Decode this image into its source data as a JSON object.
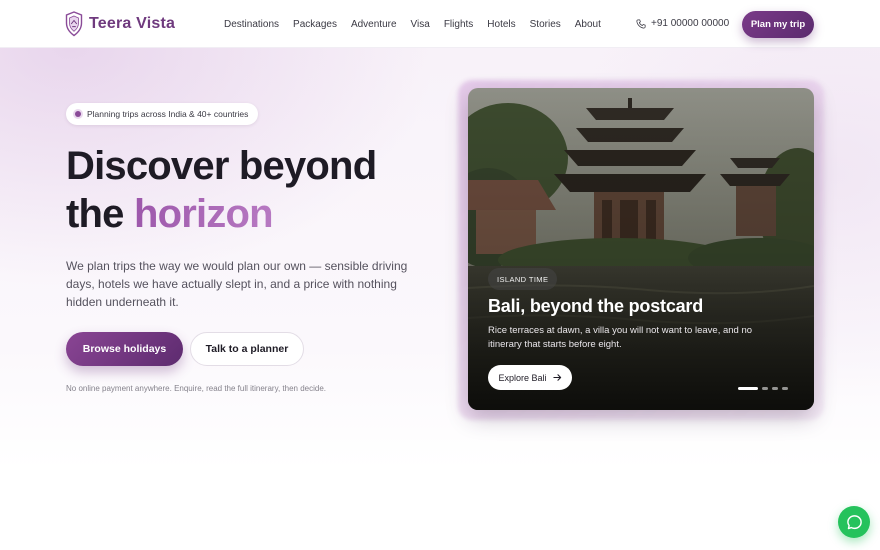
{
  "brand": {
    "name": "Teera Vista",
    "logo_icon": "shield-crest-icon",
    "color": "#6f3a7e"
  },
  "nav": {
    "items": [
      {
        "label": "Destinations"
      },
      {
        "label": "Packages"
      },
      {
        "label": "Adventure"
      },
      {
        "label": "Visa"
      },
      {
        "label": "Flights"
      },
      {
        "label": "Hotels"
      },
      {
        "label": "Stories"
      },
      {
        "label": "About"
      }
    ],
    "phone": "+91 00000 00000",
    "phone_icon": "phone-icon",
    "cta_label": "Plan my trip"
  },
  "hero": {
    "pill_text": "Planning trips across India & 40+ countries",
    "headline_line1": "Discover beyond",
    "headline_line2_plain": "the",
    "headline_line2_accent": "horizon",
    "subtext": "We plan trips the way we would plan our own — sensible driving days, hotels we have actually slept in, and a price with nothing hidden underneath it.",
    "primary_button": "Browse holidays",
    "secondary_button": "Talk to a planner",
    "fineprint": "No online payment anywhere. Enquire, read the full itinerary, then decide."
  },
  "feature_card": {
    "tag": "ISLAND TIME",
    "title": "Bali, beyond the postcard",
    "text": "Rice terraces at dawn, a villa you will not want to leave, and no itinerary that starts before eight.",
    "button_label": "Explore Bali",
    "button_icon": "arrow-right-icon",
    "carousel_slides": 4,
    "active_slide": 1
  },
  "chat_button": {
    "icon": "whatsapp-chat-icon",
    "color": "#25c25c"
  },
  "colors": {
    "accent": "#8a4594",
    "accent_dark": "#5d2b6f",
    "headline_accent": "#a15cae"
  }
}
